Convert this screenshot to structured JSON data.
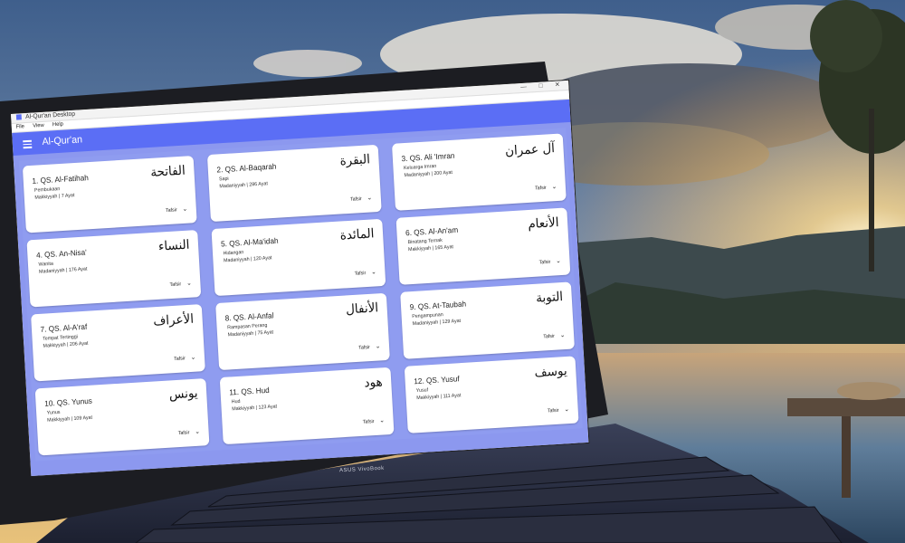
{
  "window": {
    "title": "Al-Qur'an Desktop",
    "controls": "— □ ✕",
    "menu": [
      "File",
      "View",
      "Help"
    ]
  },
  "appbar": {
    "title": "Al-Qur'an",
    "menu_icon": "hamburger-menu-icon"
  },
  "surahs": [
    {
      "title": "1. QS. Al-Fatihah",
      "arabic": "الفاتحة",
      "meaning": "Pembukaan",
      "meta": "Makkiyyah | 7 Ayat",
      "tafsir": "Tafsir"
    },
    {
      "title": "2. QS. Al-Baqarah",
      "arabic": "البقرة",
      "meaning": "Sapi",
      "meta": "Madaniyyah | 286 Ayat",
      "tafsir": "Tafsir"
    },
    {
      "title": "3. QS. Ali 'Imran",
      "arabic": "آل عمران",
      "meaning": "Keluarga Imran",
      "meta": "Madaniyyah | 200 Ayat",
      "tafsir": "Tafsir"
    },
    {
      "title": "4. QS. An-Nisa'",
      "arabic": "النساء",
      "meaning": "Wanita",
      "meta": "Madaniyyah | 176 Ayat",
      "tafsir": "Tafsir"
    },
    {
      "title": "5. QS. Al-Ma'idah",
      "arabic": "المائدة",
      "meaning": "Hidangan",
      "meta": "Madaniyyah | 120 Ayat",
      "tafsir": "Tafsir"
    },
    {
      "title": "6. QS. Al-An'am",
      "arabic": "الأنعام",
      "meaning": "Binatang Ternak",
      "meta": "Makkiyyah | 165 Ayat",
      "tafsir": "Tafsir"
    },
    {
      "title": "7. QS. Al-A'raf",
      "arabic": "الأعراف",
      "meaning": "Tempat Tertinggi",
      "meta": "Makkiyyah | 206 Ayat",
      "tafsir": "Tafsir"
    },
    {
      "title": "8. QS. Al-Anfal",
      "arabic": "الأنفال",
      "meaning": "Rampasan Perang",
      "meta": "Madaniyyah | 75 Ayat",
      "tafsir": "Tafsir"
    },
    {
      "title": "9. QS. At-Taubah",
      "arabic": "التوبة",
      "meaning": "Pengampunan",
      "meta": "Madaniyyah | 129 Ayat",
      "tafsir": "Tafsir"
    },
    {
      "title": "10. QS. Yunus",
      "arabic": "يونس",
      "meaning": "Yunus",
      "meta": "Makkiyyah | 109 Ayat",
      "tafsir": "Tafsir"
    },
    {
      "title": "11. QS. Hud",
      "arabic": "هود",
      "meaning": "Hud",
      "meta": "Makkiyyah | 123 Ayat",
      "tafsir": "Tafsir"
    },
    {
      "title": "12. QS. Yusuf",
      "arabic": "يوسف",
      "meaning": "Yusuf",
      "meta": "Makkiyyah | 111 Ayat",
      "tafsir": "Tafsir"
    }
  ],
  "device_logo": "ASUS VivoBook",
  "colors": {
    "accent": "#5b6ef5",
    "grid_bg": "#8c98ef"
  }
}
